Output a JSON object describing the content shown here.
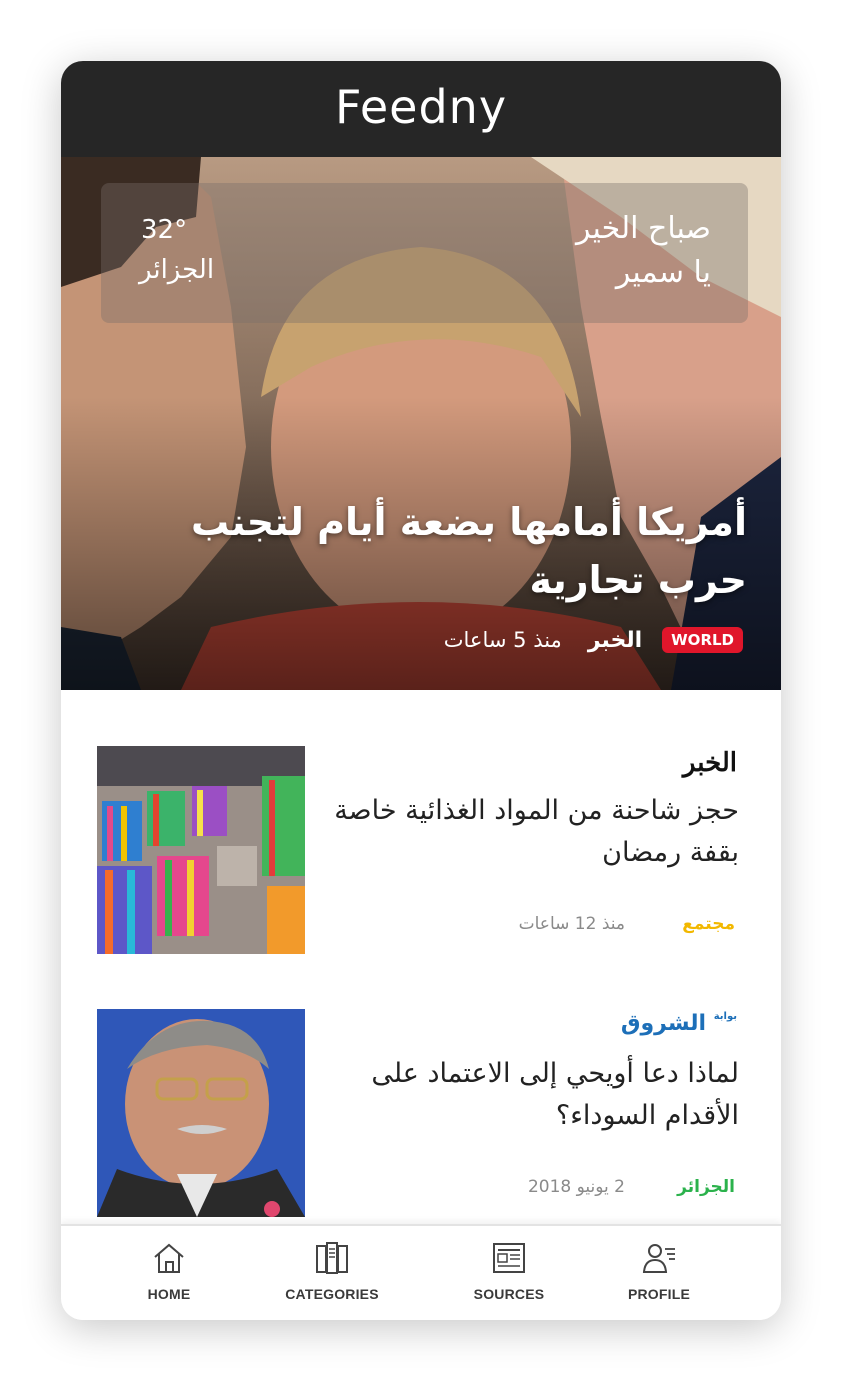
{
  "app": {
    "title": "Feedny"
  },
  "weather": {
    "temperature": "32°",
    "city": "الجزائر"
  },
  "greeting": {
    "line1": "صباح الخير",
    "line2": "يا سمير"
  },
  "hero": {
    "headline": "أمريكا أمامها بضعة أيام لتجنب حرب تجارية",
    "badge": "WORLD",
    "badge_color": "#e0162b",
    "source": "الخبر",
    "time": "منذ 5 ساعات"
  },
  "articles": [
    {
      "source_logo": "الخبر",
      "title": "حجز شاحنة من المواد الغذائية خاصة بقفة رمضان",
      "category": "مجتمع",
      "category_color": "#f2b800",
      "time": "منذ 12 ساعات"
    },
    {
      "source_logo": "الشروق",
      "source_logo_small": "بوابة",
      "title": "لماذا دعا أويحي إلى الاعتماد على الأقدام السوداء؟",
      "category": "الجزائر",
      "category_color": "#2bb24c",
      "time": "2 يونيو 2018"
    }
  ],
  "bottom_nav": {
    "items": [
      {
        "label": "HOME",
        "icon": "home-icon"
      },
      {
        "label": "CATEGORIES",
        "icon": "categories-icon"
      },
      {
        "label": "SOURCES",
        "icon": "newspaper-icon"
      },
      {
        "label": "PROFILE",
        "icon": "profile-icon"
      }
    ]
  }
}
